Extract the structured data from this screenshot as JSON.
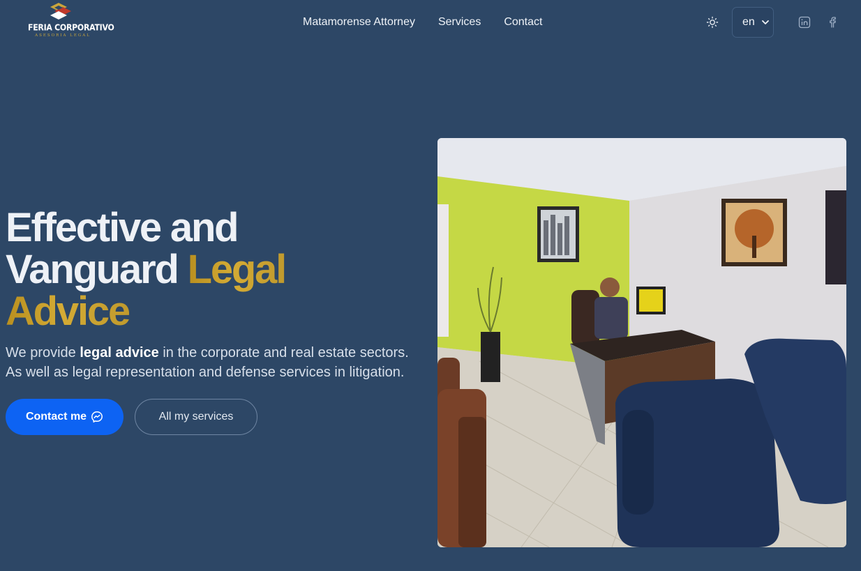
{
  "brand": {
    "name": "FERIA CORPORATIVO",
    "tagline": "ASESORIA LEGAL",
    "logo_icon": "stacked-diamond-logo",
    "colors": {
      "gold": "#c9a53b",
      "red": "#c0392b",
      "white": "#ffffff"
    }
  },
  "nav": {
    "items": [
      {
        "label": "Matamorense Attorney"
      },
      {
        "label": "Services"
      },
      {
        "label": "Contact"
      }
    ]
  },
  "toolbar": {
    "theme_icon": "sun-icon",
    "language_value": "en",
    "language_icon": "chevron-down-icon",
    "social_icons": [
      "linkedin-icon",
      "facebook-icon"
    ]
  },
  "hero": {
    "title_part1": "Effective and",
    "title_part2": "Vanguard ",
    "title_highlight_1": "Legal",
    "title_highlight_2": "Advice",
    "desc_line1_pre": "We provide ",
    "desc_line1_bold": "legal advice",
    "desc_line1_post": " in the corporate and real estate sectors.",
    "desc_line2": "As well as legal representation and defense services in litigation.",
    "primary_button": "Contact me",
    "primary_button_icon": "messenger-icon",
    "secondary_button": "All my services",
    "image_icon": "office-photo"
  },
  "colors": {
    "background": "#2d4766",
    "accent_blue": "#0d63f3",
    "gold": "#c9a53b"
  }
}
